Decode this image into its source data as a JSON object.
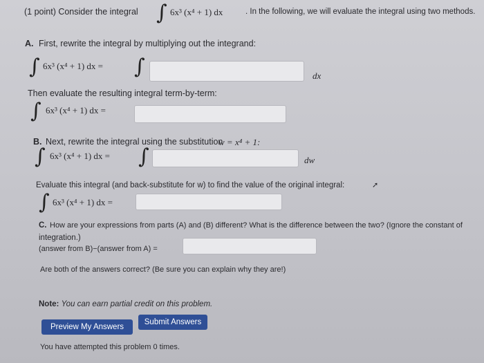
{
  "intro": {
    "points": "(1 point) Consider the integral",
    "integrand": "6x³ (x⁴ + 1) dx",
    "rest": ". In the following, we will evaluate the integral using two methods."
  },
  "partA": {
    "label": "A.",
    "text": "First, rewrite the integral by multiplying out the integrand:",
    "lhs": "6x³ (x⁴ + 1) dx =",
    "diff": "dx",
    "then_text": "Then evaluate the resulting integral term-by-term:",
    "lhs2": "6x³ (x⁴ + 1) dx ="
  },
  "partB": {
    "label": "B.",
    "text": "Next, rewrite the integral using the substitution",
    "substitution": "w = x⁴ + 1:",
    "lhs": "6x³ (x⁴ + 1) dx =",
    "diff": "dw",
    "eval_text": "Evaluate this integral (and back-substitute for w) to find the value of the original integral:",
    "lhs2": "6x³ (x⁴ + 1) dx ="
  },
  "partC": {
    "label": "C.",
    "text": "How are your expressions from parts (A) and (B) different? What is the difference between the two? (Ignore the constant of",
    "text2": "integration.)",
    "diff_label": "(answer from B)−(answer from A) =",
    "correct_q": "Are both of the answers correct? (Be sure you can explain why they are!)"
  },
  "note": {
    "label": "Note:",
    "text": "You can earn partial credit on this problem."
  },
  "buttons": {
    "preview": "Preview My Answers",
    "submit": "Submit Answers"
  },
  "attempts": "You have attempted this problem 0 times."
}
